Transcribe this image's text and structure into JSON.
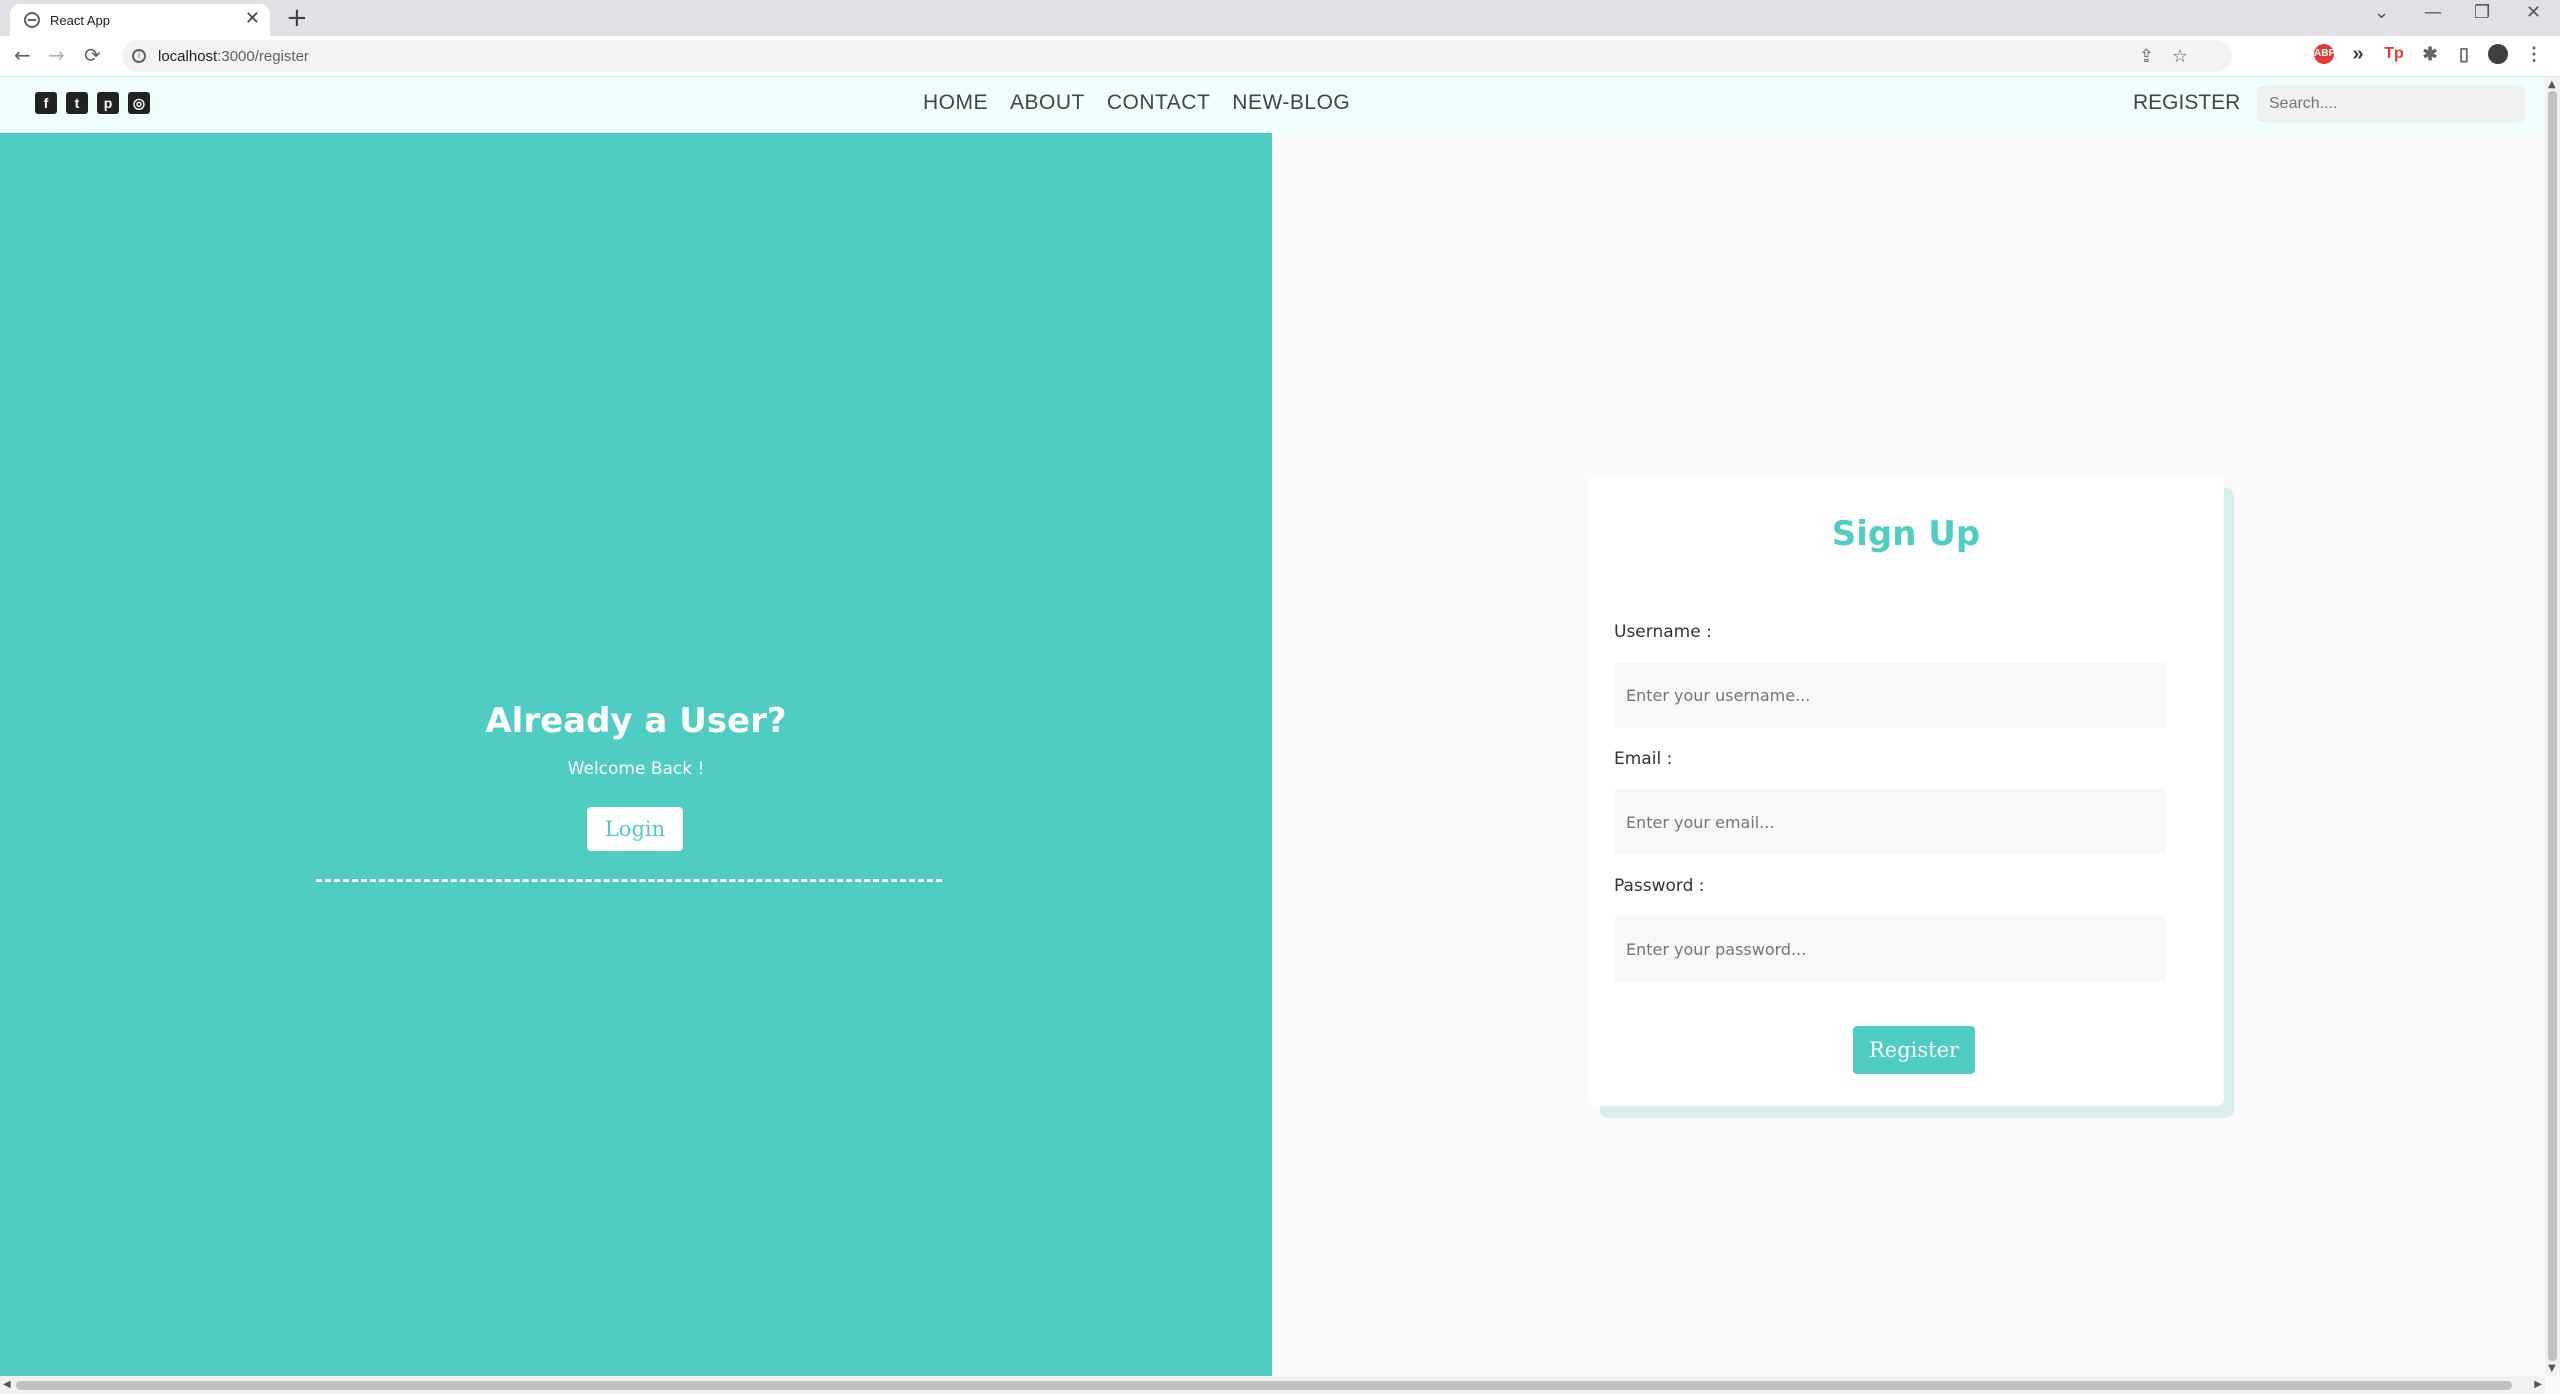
{
  "browser": {
    "tab_title": "React App",
    "tab_close": "✕",
    "new_tab": "+",
    "url_host": "localhost",
    "url_path": ":3000/register",
    "controls": {
      "minimize": "—",
      "restore": "❐",
      "close": "✕",
      "tabs_menu": "⌄"
    },
    "nav": {
      "back": "←",
      "forward": "→",
      "reload": "⟳"
    },
    "extensions": [
      "ABP",
      "»",
      "Tp"
    ]
  },
  "appnav": {
    "social": [
      {
        "name": "facebook-icon",
        "glyph": "f"
      },
      {
        "name": "twitter-icon",
        "glyph": "t"
      },
      {
        "name": "pinterest-icon",
        "glyph": "p"
      },
      {
        "name": "instagram-icon",
        "glyph": "◎"
      }
    ],
    "menu": [
      "HOME",
      "ABOUT",
      "CONTACT",
      "NEW-BLOG"
    ],
    "register": "REGISTER",
    "search_placeholder": "Search...."
  },
  "left_panel": {
    "title": "Already a User?",
    "subtitle": "Welcome Back !",
    "login_label": "Login"
  },
  "signup": {
    "title": "Sign Up",
    "username_label": "Username :",
    "username_placeholder": "Enter your username...",
    "email_label": "Email :",
    "email_placeholder": "Enter your email...",
    "password_label": "Password :",
    "password_placeholder": "Enter your password...",
    "submit_label": "Register"
  },
  "colors": {
    "accent": "#4fcdc3",
    "navbar_bg": "#effffd",
    "page_bg": "#fafafa"
  }
}
